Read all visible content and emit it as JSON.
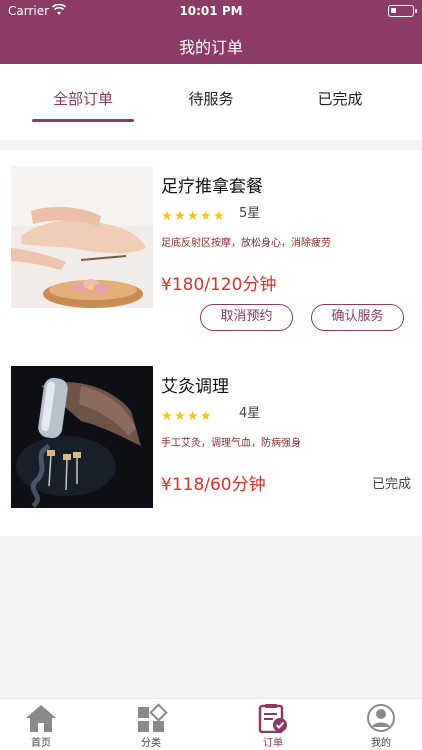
{
  "status_bar": {
    "carrier": "Carrier",
    "time": "10:01 PM"
  },
  "header": {
    "title": "我的订单"
  },
  "tabs": [
    {
      "label": "全部订单",
      "active": true
    },
    {
      "label": "待服务",
      "active": false
    },
    {
      "label": "已完成",
      "active": false
    }
  ],
  "orders": [
    {
      "name": "足疗推拿套餐",
      "stars": 5,
      "rating_label": "5星",
      "description": "足底反射区按摩，放松身心，消除疲劳",
      "price": "¥180/120分钟",
      "cancel_label": "取消预约",
      "confirm_label": "确认服务"
    },
    {
      "name": "艾灸调理",
      "stars": 4,
      "rating_label": "4星",
      "description": "手工艾灸，调理气血，防病强身",
      "price": "¥118/60分钟",
      "status": "已完成"
    }
  ],
  "tabbar": [
    {
      "label": "首页",
      "icon": "home-icon"
    },
    {
      "label": "分类",
      "icon": "category-icon"
    },
    {
      "label": "订单",
      "icon": "order-icon",
      "active": true
    },
    {
      "label": "我的",
      "icon": "profile-icon"
    }
  ],
  "colors": {
    "brand": "#8c3a66",
    "price": "#e0312a",
    "star": "#f5c518"
  }
}
